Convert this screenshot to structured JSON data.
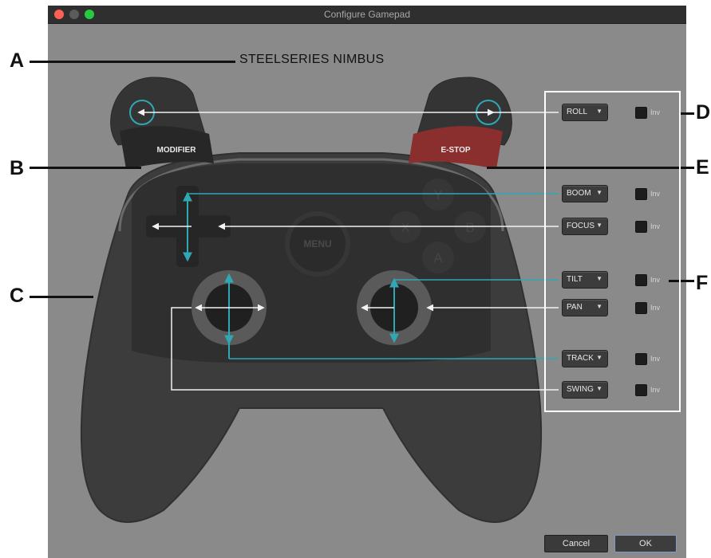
{
  "window": {
    "title": "Configure Gamepad"
  },
  "controller": {
    "model": "STEELSERIES NIMBUS",
    "modifier_label": "MODIFIER",
    "estop_label": "E-STOP",
    "menu_label": "MENU",
    "face_buttons": [
      "Y",
      "X",
      "B",
      "A"
    ]
  },
  "callouts": [
    "A",
    "B",
    "C",
    "D",
    "E",
    "F"
  ],
  "mappings": [
    {
      "axis": "ROLL",
      "inv": "Inv"
    },
    {
      "axis": "BOOM",
      "inv": "Inv"
    },
    {
      "axis": "FOCUS",
      "inv": "Inv"
    },
    {
      "axis": "TILT",
      "inv": "Inv"
    },
    {
      "axis": "PAN",
      "inv": "Inv"
    },
    {
      "axis": "TRACK",
      "inv": "Inv"
    },
    {
      "axis": "SWING",
      "inv": "Inv"
    }
  ],
  "buttons": {
    "cancel": "Cancel",
    "ok": "OK"
  },
  "colors": {
    "teal": "#2fa8b3",
    "estop": "#8a2e2e",
    "controller": "#3b3b3b",
    "window_bg": "#8a8a8a"
  }
}
